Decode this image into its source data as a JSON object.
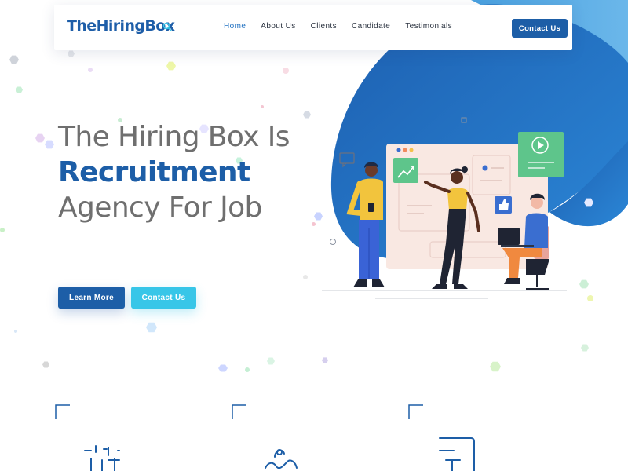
{
  "brand": {
    "logo_text": "TheHiringBox"
  },
  "nav": {
    "items": [
      {
        "label": "Home",
        "active": true
      },
      {
        "label": "About Us",
        "active": false
      },
      {
        "label": "Clients",
        "active": false
      },
      {
        "label": "Candidate",
        "active": false
      },
      {
        "label": "Testimonials",
        "active": false
      }
    ],
    "cta_label": "Contact Us"
  },
  "hero": {
    "line1": "The Hiring Box Is",
    "line2": "Recruitment",
    "line3": "Agency For Job",
    "primary_button": "Learn More",
    "secondary_button": "Contact Us"
  },
  "colors": {
    "brand_blue": "#1d5ea7",
    "accent_cyan": "#38c6e8",
    "text_gray": "#6f6f6f"
  },
  "icons": [
    "magnifier-logo-icon",
    "chart-icon",
    "play-icon",
    "thumbs-up-icon",
    "chat-icon",
    "feature-corner-icon"
  ]
}
